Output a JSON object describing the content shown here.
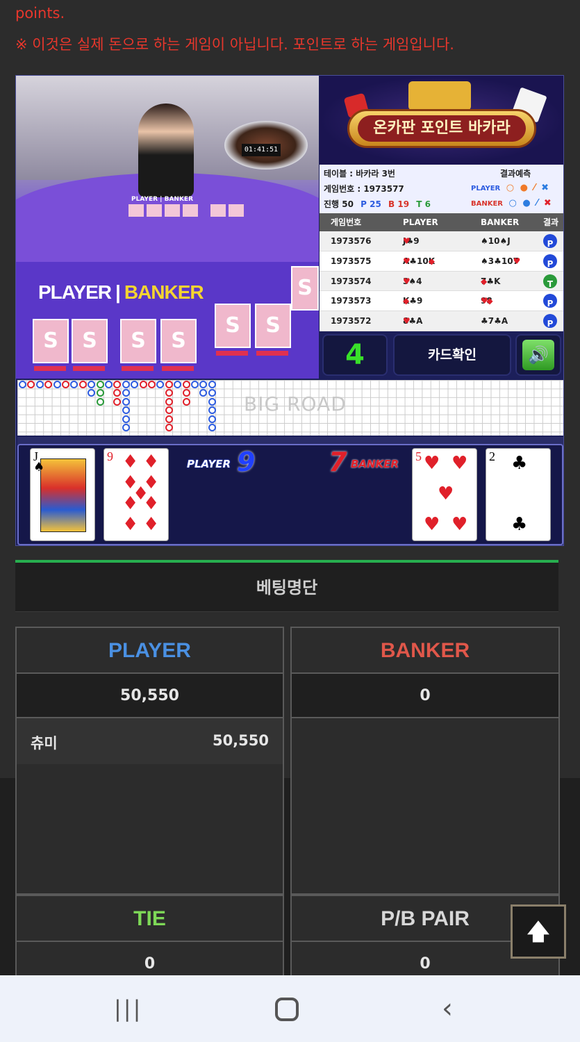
{
  "notice": {
    "line1": "points.",
    "line2": "※ 이것은 실제 돈으로 하는 게임이 아닙니다. 포인트로 하는 게임입니다."
  },
  "video": {
    "clock": "01:41:51",
    "mini_label": "PLAYER | BANKER",
    "player_label": "PLAYER",
    "banker_label": "BANKER"
  },
  "logo_text": "온카판 포인트 바카라",
  "info": {
    "table": "테이블 : 바카라 3번",
    "game_no": "게임번호 : 1973577",
    "progress_label": "진행 50",
    "p_count": "P 25",
    "b_count": "B 19",
    "t_count": "T 6",
    "prediction_label": "결과예측",
    "pred_player": "PLAYER",
    "pred_banker": "BANKER"
  },
  "history": {
    "headers": [
      "게임번호",
      "PLAYER",
      "BANKER",
      "결과"
    ],
    "rows": [
      {
        "no": "1973576",
        "player": "♥J♣9",
        "banker": "♠10♠J",
        "result": "P"
      },
      {
        "no": "1973575",
        "player": "♥A♣10◆K",
        "banker": "♠3♣10♥7",
        "result": "P"
      },
      {
        "no": "1973574",
        "player": "♥3♠4",
        "banker": "◆7♣K",
        "result": "T"
      },
      {
        "no": "1973573",
        "player": "◆K♣9",
        "banker": "♥9◆8",
        "result": "P"
      },
      {
        "no": "1973572",
        "player": "♥8♣A",
        "banker": "♣7♣A",
        "result": "P"
      }
    ]
  },
  "controls": {
    "countdown": "4",
    "card_check": "카드확인",
    "sound_icon": "speaker-icon"
  },
  "bigroad_label": "BIG ROAD",
  "result_cards": {
    "player_label": "PLAYER",
    "player_score": "9",
    "banker_label": "BANKER",
    "banker_score": "7",
    "player_cards": [
      {
        "rank": "J",
        "suit": "♠"
      },
      {
        "rank": "9",
        "suit": "♦"
      }
    ],
    "banker_cards": [
      {
        "rank": "5",
        "suit": "♥"
      },
      {
        "rank": "2",
        "suit": "♣"
      }
    ]
  },
  "bet_list_title": "베팅명단",
  "bets": {
    "player": {
      "label": "PLAYER",
      "total": "50,550",
      "entries": [
        {
          "name": "츄미",
          "amount": "50,550"
        }
      ]
    },
    "banker": {
      "label": "BANKER",
      "total": "0"
    },
    "tie": {
      "label": "TIE",
      "total": "0"
    },
    "pair": {
      "label": "P/B PAIR",
      "total": "0"
    }
  },
  "colors": {
    "player_blue": "#4a90e2",
    "banker_red": "#e0574a",
    "tie_green": "#7ed957",
    "notice_red": "#e8372c"
  },
  "nav": {
    "recent_icon": "recent-apps-icon",
    "home_icon": "home-icon",
    "back_icon": "back-icon"
  }
}
